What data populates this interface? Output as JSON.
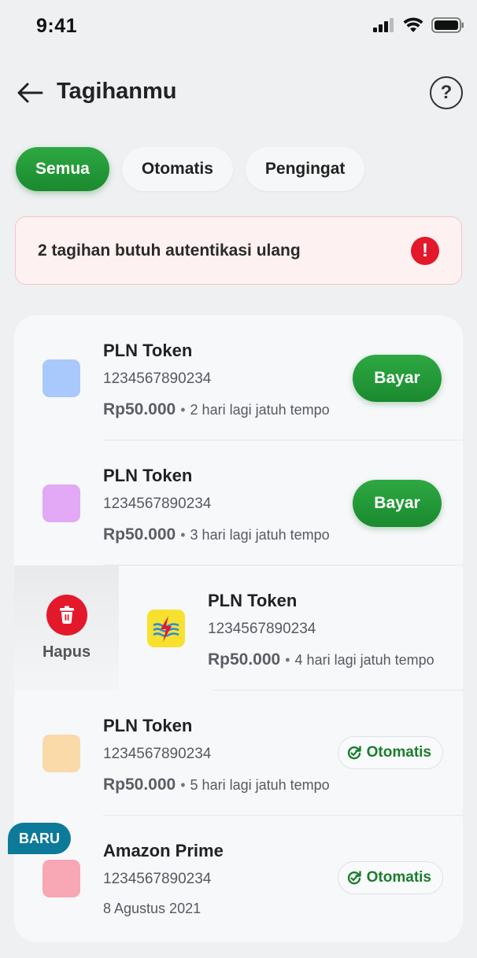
{
  "status": {
    "time": "9:41"
  },
  "header": {
    "title": "Tagihanmu",
    "help_label": "?"
  },
  "tabs": [
    {
      "label": "Semua",
      "active": true
    },
    {
      "label": "Otomatis",
      "active": false
    },
    {
      "label": "Pengingat",
      "active": false
    }
  ],
  "alert": {
    "text": "2 tagihan butuh autentikasi ulang",
    "icon": "!"
  },
  "delete_action": {
    "label": "Hapus"
  },
  "bills": [
    {
      "name": "PLN Token",
      "number": "1234567890234",
      "amount": "Rp50.000",
      "due": "2 hari lagi jatuh tempo",
      "action": "Bayar",
      "thumb_color": "#a9c8fb"
    },
    {
      "name": "PLN Token",
      "number": "1234567890234",
      "amount": "Rp50.000",
      "due": "3 hari lagi jatuh tempo",
      "action": "Bayar",
      "thumb_color": "#e3a8f6"
    },
    {
      "name": "PLN Token",
      "number": "1234567890234",
      "amount": "Rp50.000",
      "due": "4 hari lagi jatuh tempo",
      "thumb_color": "#f7e12e"
    },
    {
      "name": "PLN Token",
      "number": "1234567890234",
      "amount": "Rp50.000",
      "due": "5 hari lagi jatuh tempo",
      "action": "Otomatis",
      "thumb_color": "#f9daa8"
    },
    {
      "name": "Amazon Prime",
      "number": "1234567890234",
      "date": "8 Agustus 2021",
      "action": "Otomatis",
      "badge": "BARU",
      "thumb_color": "#f8a7b5"
    }
  ],
  "colors": {
    "primary_green": "#1f9137",
    "danger_red": "#e3192b",
    "badge_teal": "#0e7a9a"
  }
}
